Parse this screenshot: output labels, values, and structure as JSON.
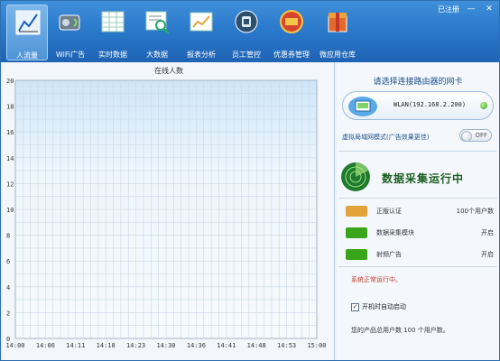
{
  "window": {
    "controls": {
      "registered": "已注册",
      "minimize": "—",
      "close": "✕"
    }
  },
  "toolbar": {
    "items": [
      {
        "label": "人流量",
        "icon": "traffic-chart-icon",
        "active": true
      },
      {
        "label": "WiFi广告",
        "icon": "wifi-ad-icon",
        "active": false
      },
      {
        "label": "实时数据",
        "icon": "realtime-table-icon",
        "active": false
      },
      {
        "label": "大数据",
        "icon": "big-data-icon",
        "active": false
      },
      {
        "label": "报表分析",
        "icon": "report-analysis-icon",
        "active": false
      },
      {
        "label": "员工管控",
        "icon": "staff-control-icon",
        "active": false
      },
      {
        "label": "优惠券管理",
        "icon": "coupon-icon",
        "active": false
      },
      {
        "label": "微应用仓库",
        "icon": "app-store-icon",
        "active": false
      }
    ]
  },
  "chart_data": {
    "type": "line",
    "title": "在线人数",
    "xlabel": "",
    "ylabel": "",
    "x_ticks": [
      "14:00",
      "14:06",
      "14:11",
      "14:18",
      "14:23",
      "14:30",
      "14:36",
      "14:41",
      "14:48",
      "14:53",
      "15:00"
    ],
    "y_ticks": [
      0,
      2,
      4,
      6,
      8,
      10,
      12,
      14,
      16,
      18,
      20
    ],
    "ylim": [
      0,
      20
    ],
    "grid": true,
    "series": [
      {
        "values": []
      }
    ]
  },
  "right_panel": {
    "nic_prompt": "请选择连接路由器的网卡",
    "nic_value": "WLAN(192.168.2.200)",
    "vlan_label": "虚拟局域网模式(广告效果更佳)",
    "vlan_toggle": "OFF",
    "status_title": "数据采集运行中",
    "rows": [
      {
        "name": "正版认证",
        "value": "100个用户数",
        "icon": "certificate-icon",
        "color": "#e2a33a"
      },
      {
        "name": "数据采集模块",
        "value": "开启",
        "icon": "module-on-icon",
        "color": "#3aa51a"
      },
      {
        "name": "射频广告",
        "value": "开启",
        "icon": "rf-ad-on-icon",
        "color": "#3aa51a"
      }
    ],
    "system_status": "系统正常运行中。",
    "autostart_label": "开机时自动启动",
    "autostart_checked": "✓",
    "product_info": "您的产品总用户数 100 个用户数。"
  },
  "colors": {
    "toolbar": "#2b7acc",
    "accent_green": "#3aa51a",
    "status_red": "#c0392b"
  }
}
